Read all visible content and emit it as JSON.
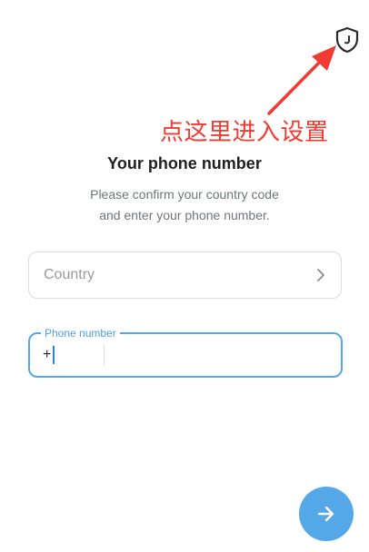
{
  "annotation": {
    "text": "点这里进入设置",
    "color": "#f03a32"
  },
  "header": {
    "title": "Your phone number",
    "subtitle_line1": "Please confirm your country code",
    "subtitle_line2": "and enter your phone number."
  },
  "country_field": {
    "placeholder": "Country",
    "chevron_icon": "chevron-right-icon"
  },
  "phone_field": {
    "legend": "Phone number",
    "prefix": "+",
    "value": ""
  },
  "icons": {
    "top_right": "shield-icon",
    "next": "arrow-right-icon"
  },
  "colors": {
    "accent": "#55a8e8",
    "text": "#1f1f1f",
    "secondary_text": "#707579"
  }
}
